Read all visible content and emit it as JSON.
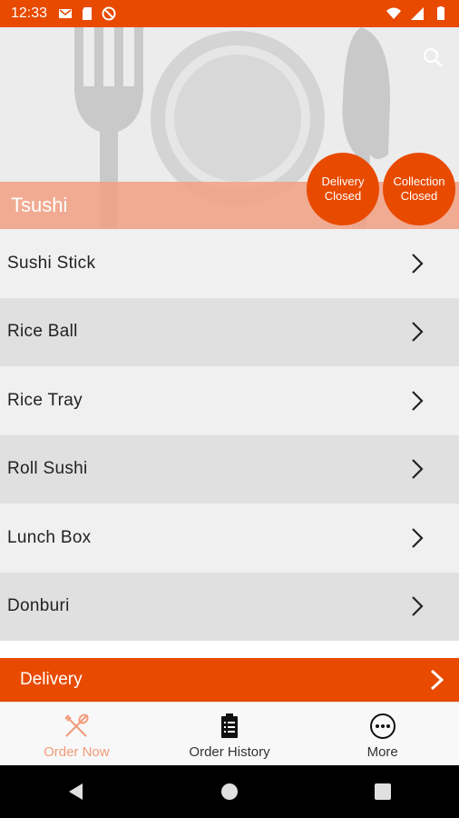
{
  "status_bar": {
    "time": "12:33",
    "left_icons": [
      "mail-icon",
      "sd-card-icon",
      "do-not-disturb-icon"
    ],
    "right_icons": [
      "wifi-icon",
      "signal-icon",
      "battery-icon"
    ]
  },
  "header": {
    "restaurant_name": "Tsushi",
    "delivery_status": [
      "Delivery",
      "Closed"
    ],
    "collection_status": [
      "Collection",
      "Closed"
    ],
    "search_icon": "search-icon"
  },
  "menu": {
    "categories": [
      {
        "label": "Sushi Stick"
      },
      {
        "label": "Rice Ball"
      },
      {
        "label": "Rice Tray"
      },
      {
        "label": "Roll Sushi"
      },
      {
        "label": "Lunch Box"
      },
      {
        "label": "Donburi"
      }
    ]
  },
  "order_mode": {
    "label": "Delivery"
  },
  "bottom_nav": {
    "items": [
      {
        "label": "Order Now",
        "icon": "fork-knife-icon",
        "active": true
      },
      {
        "label": "Order History",
        "icon": "clipboard-icon",
        "active": false
      },
      {
        "label": "More",
        "icon": "more-dots-icon",
        "active": false
      }
    ]
  },
  "colors": {
    "brand": "#e84a00",
    "active_nav": "#f39a7a"
  }
}
